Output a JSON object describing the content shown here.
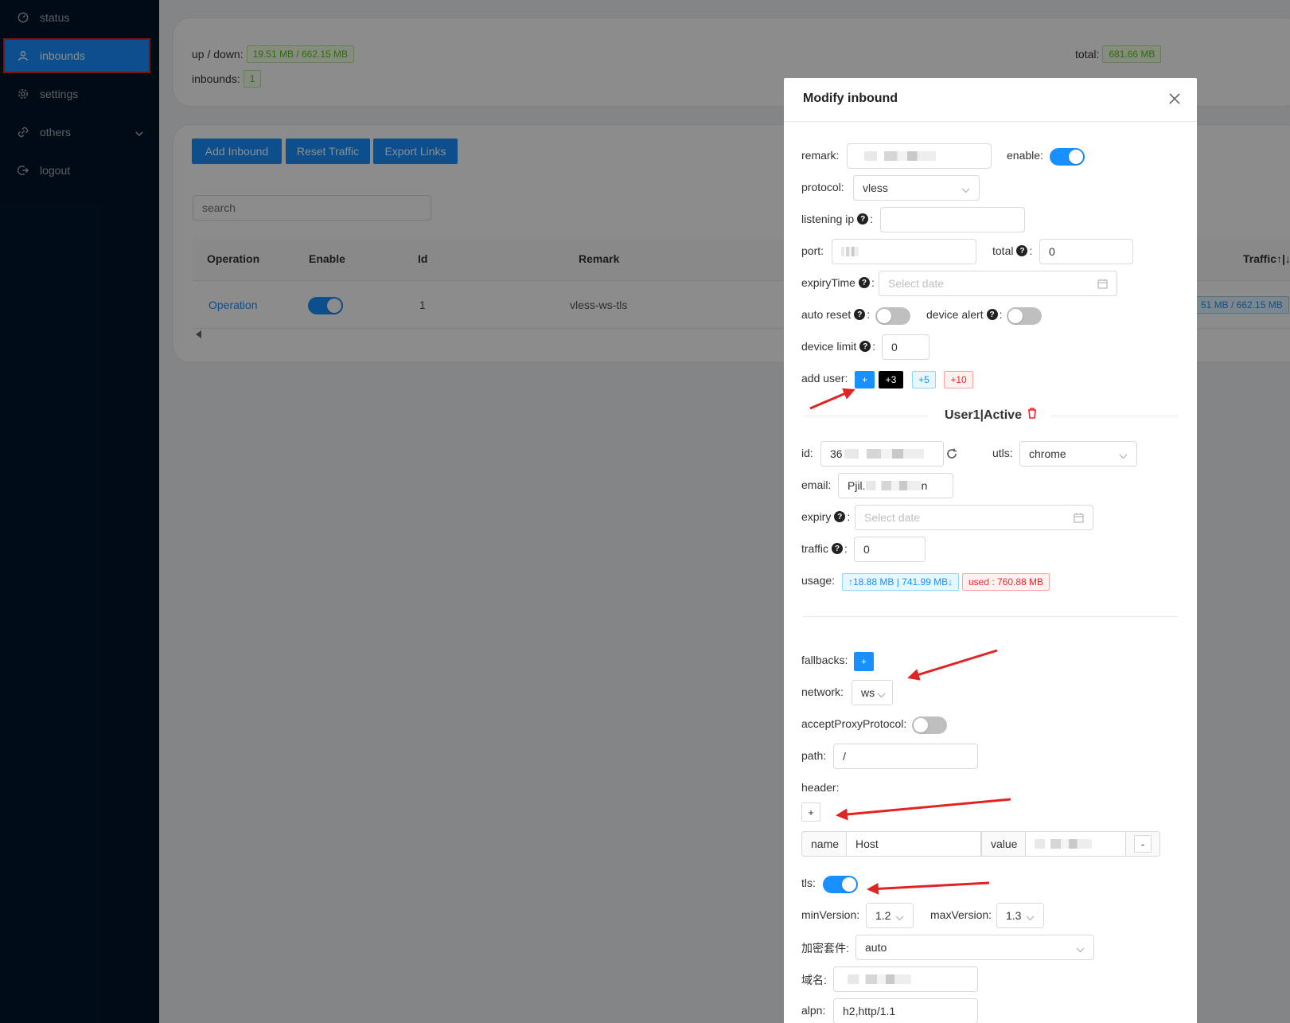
{
  "sidebar": {
    "items": [
      {
        "label": "status",
        "icon": "dashboard-icon"
      },
      {
        "label": "inbounds",
        "icon": "user-icon"
      },
      {
        "label": "settings",
        "icon": "gear-icon"
      },
      {
        "label": "others",
        "icon": "link-icon"
      },
      {
        "label": "logout",
        "icon": "logout-icon"
      }
    ]
  },
  "stats": {
    "updown_label": "up / down:",
    "updown_value": "19.51 MB / 662.15 MB",
    "inbounds_label": "inbounds:",
    "inbounds_value": "1",
    "total_label": "total:",
    "total_value": "681.66 MB"
  },
  "toolbar": {
    "add_label": "Add Inbound",
    "reset_label": "Reset Traffic",
    "export_label": "Export Links",
    "search_placeholder": "search"
  },
  "table": {
    "headers": [
      "Operation",
      "Enable",
      "Id",
      "Remark",
      "Traffic↑|↓"
    ],
    "rows": [
      {
        "operation": "Operation",
        "enable": true,
        "id": "1",
        "remark": "vless-ws-tls",
        "traffic": "51 MB / 662.15 MB"
      }
    ]
  },
  "modal": {
    "title": "Modify inbound",
    "remark_label": "remark:",
    "enable_label": "enable:",
    "protocol_label": "protocol:",
    "protocol_value": "vless",
    "listening_ip_label": "listening ip",
    "port_label": "port:",
    "total_label": "total",
    "total_value": "0",
    "expiry_label": "expiryTime",
    "expiry_placeholder": "Select date",
    "auto_reset_label": "auto reset",
    "device_alert_label": "device alert",
    "device_limit_label": "device limit",
    "device_limit_value": "0",
    "add_user_label": "add user:",
    "add_user_buttons": [
      "+",
      "+3",
      "+5",
      "+10"
    ],
    "user_section_title": "User1|Active",
    "id_label": "id:",
    "id_value": "36",
    "utls_label": "utls:",
    "utls_value": "chrome",
    "email_label": "email:",
    "email_value": "Pjil.",
    "email_suffix": "n",
    "user_expiry_label": "expiry",
    "user_expiry_placeholder": "Select date",
    "traffic_label": "traffic",
    "traffic_value": "0",
    "usage_label": "usage:",
    "usage_updown": "↑18.88 MB | 741.99 MB↓",
    "usage_used": "used : 760.88 MB",
    "fallbacks_label": "fallbacks:",
    "fallbacks_btn": "+",
    "network_label": "network:",
    "network_value": "ws",
    "accept_proxy_label": "acceptProxyProtocol:",
    "path_label": "path:",
    "path_value": "/",
    "header_label": "header:",
    "header_add_btn": "+",
    "header_name_label": "name",
    "header_name_value": "Host",
    "header_value_label": "value",
    "header_remove_btn": "-",
    "tls_label": "tls:",
    "min_version_label": "minVersion:",
    "min_version_value": "1.2",
    "max_version_label": "maxVersion:",
    "max_version_value": "1.3",
    "cipher_label": "加密套件:",
    "cipher_value": "auto",
    "domain_label": "域名:",
    "alpn_label": "alpn:",
    "alpn_value": "h2,http/1.1"
  },
  "colors": {
    "primary": "#1890ff",
    "sidebar_bg": "#001529",
    "annotation_red": "#e02424"
  }
}
